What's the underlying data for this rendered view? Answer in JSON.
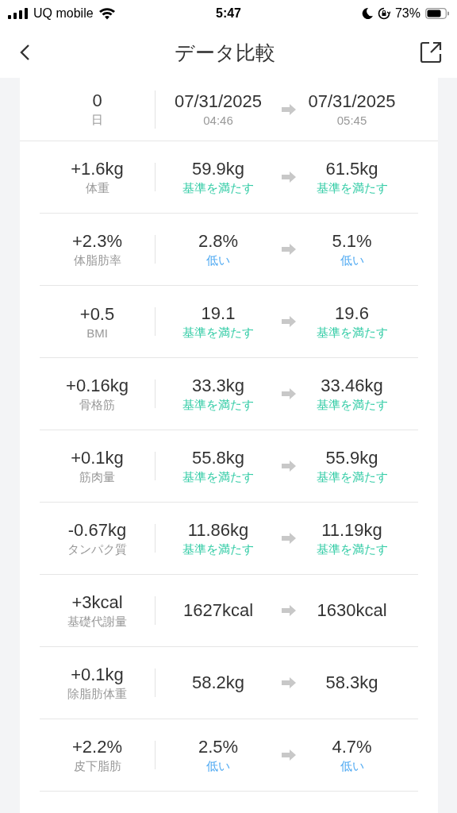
{
  "status_bar": {
    "carrier": "UQ mobile",
    "time": "5:47",
    "battery": "73%"
  },
  "nav": {
    "title": "データ比較"
  },
  "period": {
    "days": "0",
    "days_unit": "日",
    "from": {
      "date": "07/31/2025",
      "time": "04:46"
    },
    "to": {
      "date": "07/31/2025",
      "time": "05:45"
    }
  },
  "metrics": [
    {
      "change": "+1.6kg",
      "name": "体重",
      "before": {
        "value": "59.9kg",
        "status": {
          "kind": "normal",
          "text": "基準を満たす"
        }
      },
      "after": {
        "value": "61.5kg",
        "status": {
          "kind": "normal",
          "text": "基準を満たす"
        }
      }
    },
    {
      "change": "+2.3%",
      "name": "体脂肪率",
      "before": {
        "value": "2.8%",
        "status": {
          "kind": "low",
          "text": "低い"
        }
      },
      "after": {
        "value": "5.1%",
        "status": {
          "kind": "low",
          "text": "低い"
        }
      }
    },
    {
      "change": "+0.5",
      "name": "BMI",
      "before": {
        "value": "19.1",
        "status": {
          "kind": "normal",
          "text": "基準を満たす"
        }
      },
      "after": {
        "value": "19.6",
        "status": {
          "kind": "normal",
          "text": "基準を満たす"
        }
      }
    },
    {
      "change": "+0.16kg",
      "name": "骨格筋",
      "before": {
        "value": "33.3kg",
        "status": {
          "kind": "normal",
          "text": "基準を満たす"
        }
      },
      "after": {
        "value": "33.46kg",
        "status": {
          "kind": "normal",
          "text": "基準を満たす"
        }
      }
    },
    {
      "change": "+0.1kg",
      "name": "筋肉量",
      "before": {
        "value": "55.8kg",
        "status": {
          "kind": "normal",
          "text": "基準を満たす"
        }
      },
      "after": {
        "value": "55.9kg",
        "status": {
          "kind": "normal",
          "text": "基準を満たす"
        }
      }
    },
    {
      "change": "-0.67kg",
      "name": "タンパク質",
      "before": {
        "value": "11.86kg",
        "status": {
          "kind": "normal",
          "text": "基準を満たす"
        }
      },
      "after": {
        "value": "11.19kg",
        "status": {
          "kind": "normal",
          "text": "基準を満たす"
        }
      }
    },
    {
      "change": "+3kcal",
      "name": "基礎代謝量",
      "before": {
        "value": "1627kcal"
      },
      "after": {
        "value": "1630kcal"
      }
    },
    {
      "change": "+0.1kg",
      "name": "除脂肪体重",
      "before": {
        "value": "58.2kg"
      },
      "after": {
        "value": "58.3kg"
      }
    },
    {
      "change": "+2.2%",
      "name": "皮下脂肪",
      "before": {
        "value": "2.5%",
        "status": {
          "kind": "low",
          "text": "低い"
        }
      },
      "after": {
        "value": "4.7%",
        "status": {
          "kind": "low",
          "text": "低い"
        }
      }
    }
  ]
}
